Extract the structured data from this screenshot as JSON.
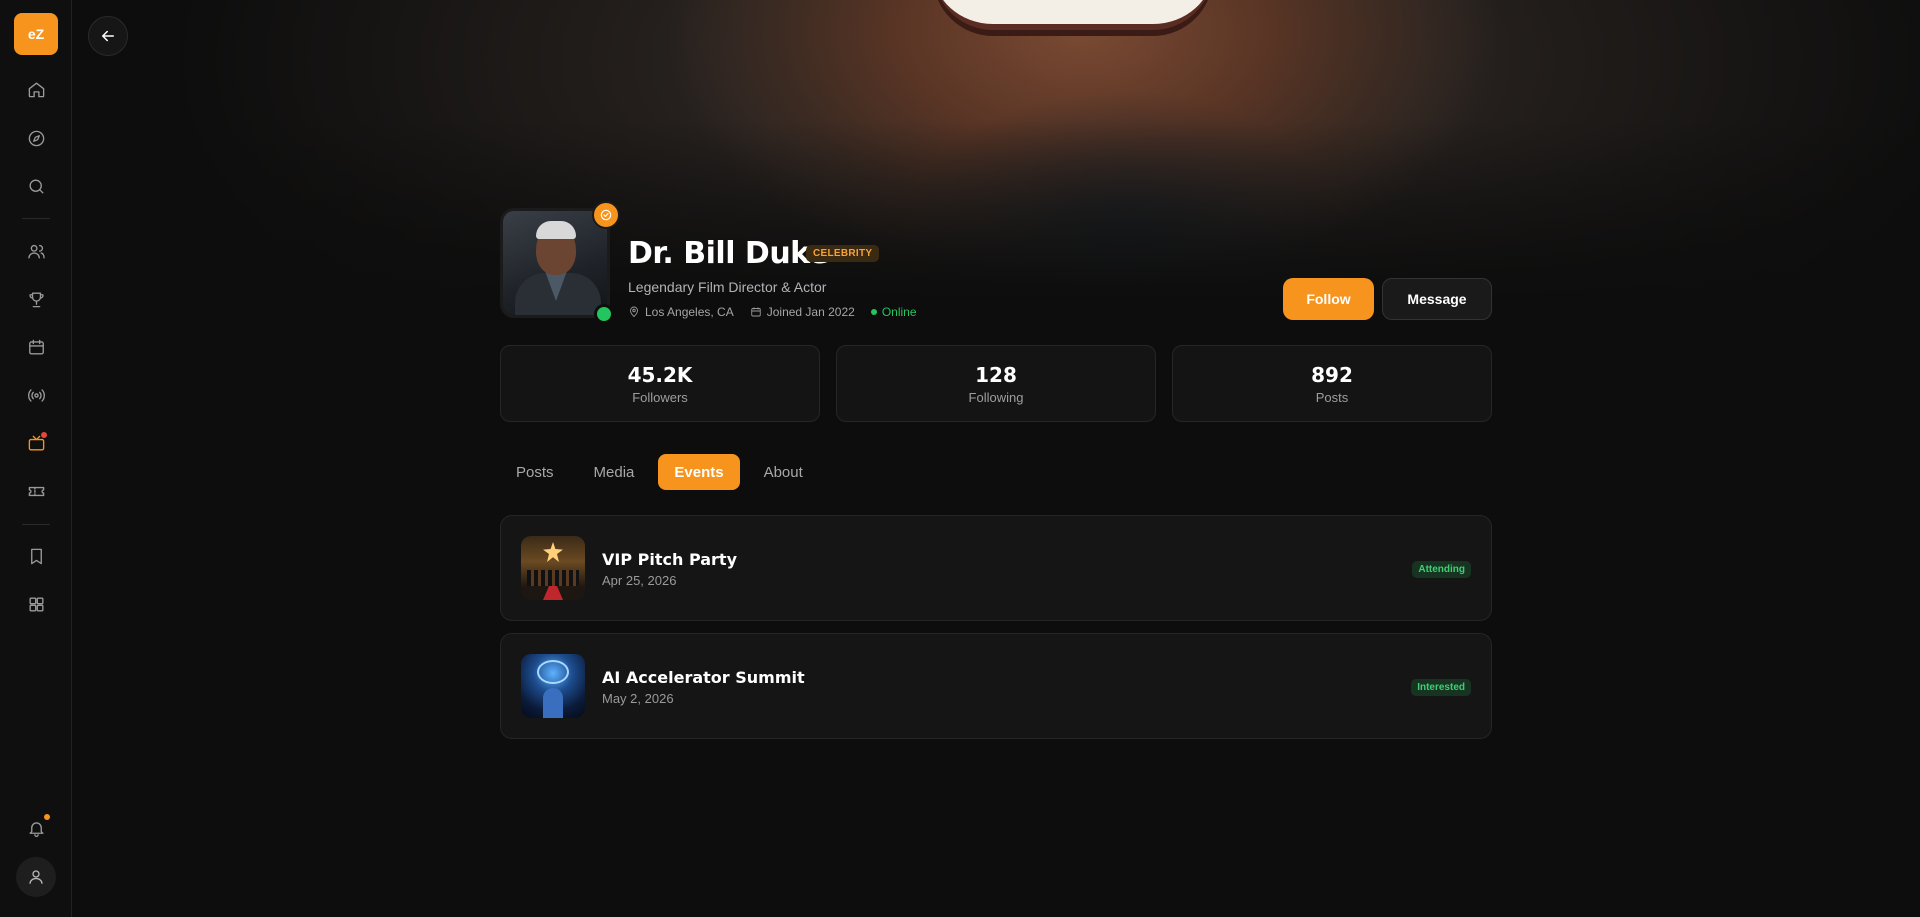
{
  "sidebar": {
    "logo_text": "eZ",
    "items": [
      {
        "icon": "home-icon"
      },
      {
        "icon": "compass-icon"
      },
      {
        "icon": "search-icon"
      },
      {
        "icon": "users-icon"
      },
      {
        "icon": "trophy-icon"
      },
      {
        "icon": "calendar-icon"
      },
      {
        "icon": "broadcast-icon"
      },
      {
        "icon": "tv-icon"
      },
      {
        "icon": "ticket-icon"
      },
      {
        "icon": "bookmark-icon"
      },
      {
        "icon": "grid-icon"
      },
      {
        "icon": "bell-icon"
      },
      {
        "icon": "user-icon"
      }
    ]
  },
  "profile": {
    "name": "Dr. Bill Duke",
    "badge": "CELEBRITY",
    "tagline": "Legendary Film Director & Actor",
    "location": "Los Angeles, CA",
    "joined": "Joined Jan 2022",
    "status": "Online"
  },
  "actions": {
    "follow_label": "Follow",
    "message_label": "Message"
  },
  "stats": [
    {
      "value": "45.2K",
      "label": "Followers"
    },
    {
      "value": "128",
      "label": "Following"
    },
    {
      "value": "892",
      "label": "Posts"
    }
  ],
  "tabs": [
    {
      "label": "Posts",
      "active": false
    },
    {
      "label": "Media",
      "active": false
    },
    {
      "label": "Events",
      "active": true
    },
    {
      "label": "About",
      "active": false
    }
  ],
  "events": [
    {
      "title": "VIP Pitch Party",
      "date": "Apr 25, 2026",
      "status": "Attending"
    },
    {
      "title": "AI Accelerator Summit",
      "date": "May 2, 2026",
      "status": "Interested"
    }
  ],
  "colors": {
    "accent": "#f7941d",
    "online": "#22c55e",
    "background": "#0d0d0d"
  }
}
